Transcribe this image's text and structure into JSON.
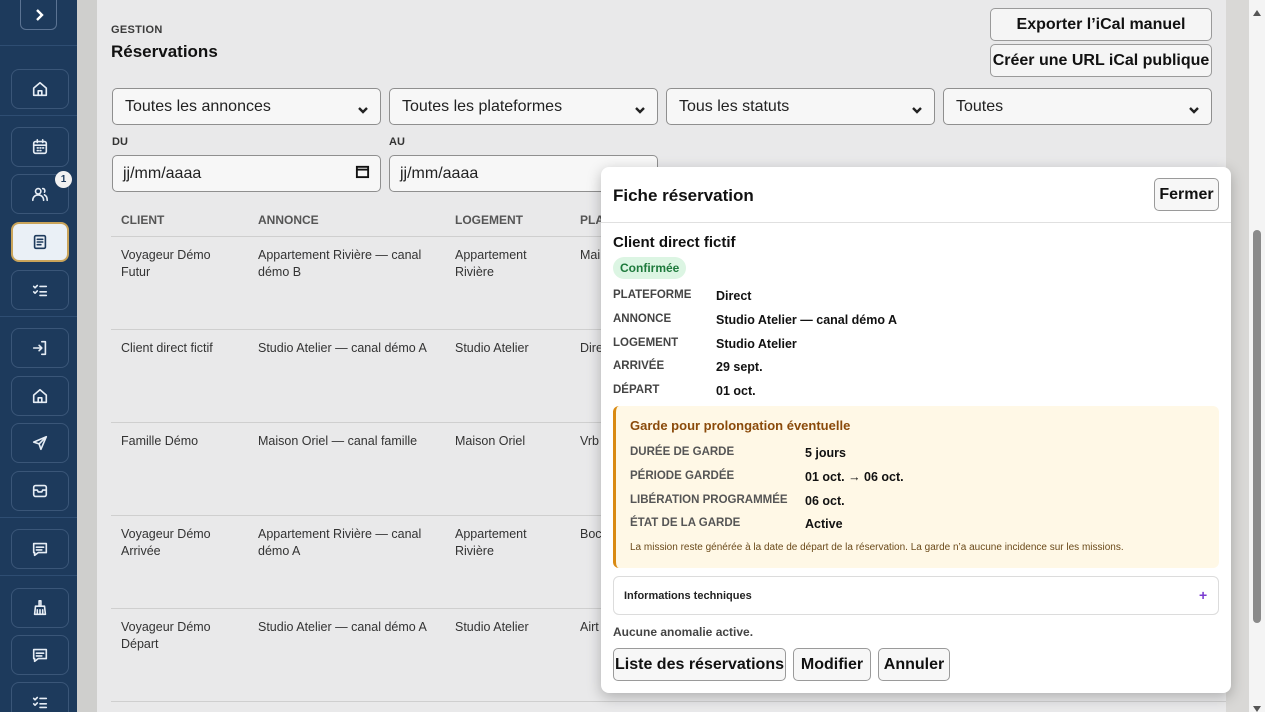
{
  "sidebar": {
    "toggle_icon": "chevron-right-icon",
    "items": [
      {
        "icon": "home-icon"
      },
      {
        "icon": "calendar-icon"
      },
      {
        "icon": "users-icon",
        "badge": "1"
      },
      {
        "icon": "document-icon",
        "active": true
      },
      {
        "icon": "checklist-icon"
      },
      {
        "icon": "login-icon"
      },
      {
        "icon": "home-icon"
      },
      {
        "icon": "send-icon"
      },
      {
        "icon": "inbox-icon"
      },
      {
        "icon": "message-icon"
      },
      {
        "icon": "cleaning-icon"
      },
      {
        "icon": "message-icon"
      },
      {
        "icon": "checklist-icon"
      }
    ]
  },
  "header": {
    "eyebrow": "GESTION",
    "title": "Réservations",
    "export_button": "Exporter l’iCal manuel",
    "create_url_button": "Créer une URL iCal publique"
  },
  "filters": {
    "listings": "Toutes les annonces",
    "platforms": "Toutes les plateformes",
    "statuses": "Tous les statuts",
    "fourth": "Toutes",
    "from_label": "DU",
    "to_label": "AU",
    "from_placeholder": "jj/mm/aaaa",
    "to_placeholder": "jj/mm/aaaa"
  },
  "table": {
    "headers": [
      "CLIENT",
      "ANNONCE",
      "LOGEMENT",
      "PLA"
    ],
    "rows": [
      {
        "client": "Voyageur Démo Futur",
        "annonce": "Appartement Rivière — canal démo B",
        "logement": "Appartement Rivière",
        "plateforme": "Mai"
      },
      {
        "client": "Client direct fictif",
        "annonce": "Studio Atelier — canal démo A",
        "logement": "Studio Atelier",
        "plateforme": "Dire"
      },
      {
        "client": "Famille Démo",
        "annonce": "Maison Oriel — canal famille",
        "logement": "Maison Oriel",
        "plateforme": "Vrb"
      },
      {
        "client": "Voyageur Démo Arrivée",
        "annonce": "Appartement Rivière — canal démo A",
        "logement": "Appartement Rivière",
        "plateforme": "Boc"
      },
      {
        "client": "Voyageur Démo Départ",
        "annonce": "Studio Atelier — canal démo A",
        "logement": "Studio Atelier",
        "plateforme": "Airt"
      }
    ]
  },
  "modal": {
    "title": "Fiche réservation",
    "close_button": "Fermer",
    "client": "Client direct fictif",
    "status": "Confirmée",
    "fields": [
      {
        "label": "PLATEFORME",
        "value": "Direct"
      },
      {
        "label": "ANNONCE",
        "value": "Studio Atelier — canal démo A"
      },
      {
        "label": "LOGEMENT",
        "value": "Studio Atelier"
      },
      {
        "label": "ARRIVÉE",
        "value": "29 sept."
      },
      {
        "label": "DÉPART",
        "value": "01 oct."
      }
    ],
    "hold": {
      "title": "Garde pour prolongation éventuelle",
      "fields": [
        {
          "label": "DURÉE DE GARDE",
          "value": "5 jours"
        },
        {
          "label": "PÉRIODE GARDÉE",
          "value": "01 oct. → 06 oct."
        },
        {
          "label": "LIBÉRATION PROGRAMMÉE",
          "value": "06 oct."
        },
        {
          "label": "ÉTAT DE LA GARDE",
          "value": "Active"
        }
      ],
      "note": "La mission reste générée à la date de départ de la réservation. La garde n’a aucune incidence sur les missions."
    },
    "tech_label": "Informations techniques",
    "tech_toggle": "+",
    "anomalies": "Aucune anomalie active.",
    "actions": {
      "list": "Liste des réservations",
      "edit": "Modifier",
      "cancel": "Annuler"
    }
  },
  "colors": {
    "sidebar": "#1d3a5c",
    "accent_active": "#c9a45a",
    "status_green": "#1e7a3c",
    "hold_border": "#d98a12"
  }
}
